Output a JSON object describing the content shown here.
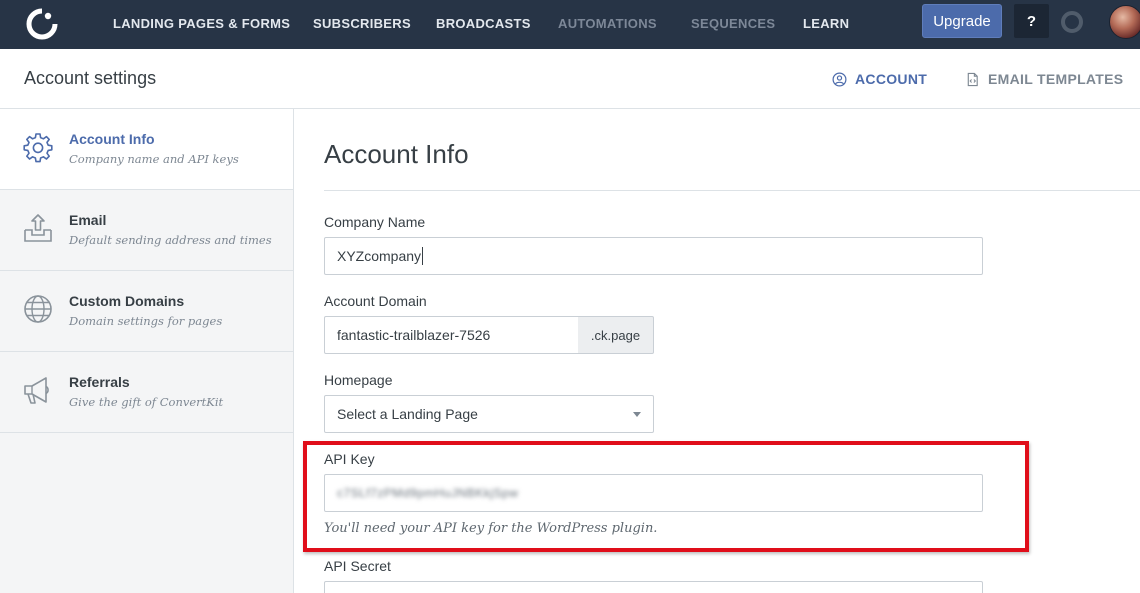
{
  "nav": {
    "items": [
      {
        "label": "LANDING PAGES & FORMS"
      },
      {
        "label": "SUBSCRIBERS"
      },
      {
        "label": "BROADCASTS"
      },
      {
        "label": "AUTOMATIONS"
      },
      {
        "label": "SEQUENCES"
      },
      {
        "label": "LEARN"
      }
    ],
    "upgrade_label": "Upgrade",
    "help_label": "?"
  },
  "header": {
    "title": "Account settings",
    "tabs": [
      {
        "label": "ACCOUNT",
        "icon": "user-circle-icon",
        "active": true
      },
      {
        "label": "EMAIL TEMPLATES",
        "icon": "file-code-icon",
        "active": false
      }
    ]
  },
  "sidebar": {
    "items": [
      {
        "title": "Account Info",
        "subtitle": "Company name and API keys",
        "icon": "gear-icon",
        "active": true
      },
      {
        "title": "Email",
        "subtitle": "Default sending address and times",
        "icon": "inbox-upload-icon",
        "active": false
      },
      {
        "title": "Custom Domains",
        "subtitle": "Domain settings for pages",
        "icon": "globe-icon",
        "active": false
      },
      {
        "title": "Referrals",
        "subtitle": "Give the gift of ConvertKit",
        "icon": "megaphone-icon",
        "active": false
      }
    ]
  },
  "main": {
    "title": "Account Info",
    "company_name": {
      "label": "Company Name",
      "value": "XYZcompany"
    },
    "account_domain": {
      "label": "Account Domain",
      "value": "fantastic-trailblazer-7526",
      "suffix": ".ck.page"
    },
    "homepage": {
      "label": "Homepage",
      "selected": "Select a Landing Page"
    },
    "api_key": {
      "label": "API Key",
      "value": "c7SLf7zPMd9pmHuJNBKkjSpw",
      "note": "You'll need your API key for the WordPress plugin."
    },
    "api_secret": {
      "label": "API Secret"
    }
  },
  "colors": {
    "nav_bg": "#273446",
    "accent": "#4c6bab",
    "highlight": "#e00e1a"
  }
}
